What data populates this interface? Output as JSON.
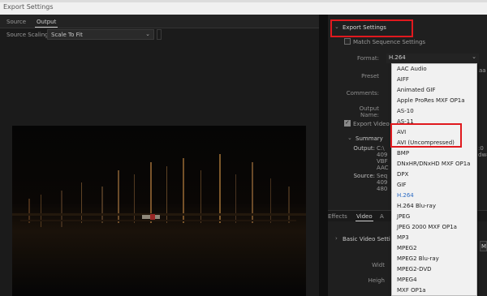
{
  "window": {
    "title": "Export Settings"
  },
  "left": {
    "tabs": [
      {
        "label": "Source"
      },
      {
        "label": "Output",
        "active": true
      }
    ],
    "source_scaling": {
      "label": "Source Scaling:",
      "value": "Scale To Fit"
    }
  },
  "right": {
    "section_title": "Export Settings",
    "match_sequence": "Match Sequence Settings",
    "format_label": "Format:",
    "format_value": "H.264",
    "preset_label": "Preset",
    "comments_label": "Comments:",
    "output_name_label": "Output Name:",
    "export_video": "Export Video",
    "summary": {
      "title": "Summary",
      "output_label": "Output:",
      "output_lines": [
        "C:\\",
        "409",
        "VBF",
        "AAC"
      ],
      "output_right": [
        ":0",
        "dwa"
      ],
      "source_label": "Source:",
      "source_lines": [
        "Seq",
        "409",
        "480"
      ]
    },
    "bottom_tabs": [
      {
        "label": "Effects"
      },
      {
        "label": "Video",
        "active": true
      },
      {
        "label": "A"
      }
    ],
    "basic_video": "Basic Video Setti",
    "width_label": "Widt",
    "height_label": "Heigh",
    "truncated": {
      "aa": "aa",
      "m": "M"
    }
  },
  "dropdown": {
    "items": [
      {
        "label": "AAC Audio"
      },
      {
        "label": "AIFF"
      },
      {
        "label": "Animated GIF"
      },
      {
        "label": "Apple ProRes MXF OP1a"
      },
      {
        "label": "AS-10"
      },
      {
        "label": "AS-11"
      },
      {
        "label": "AVI"
      },
      {
        "label": "AVI (Uncompressed)"
      },
      {
        "label": "BMP"
      },
      {
        "label": "DNxHR/DNxHD MXF OP1a"
      },
      {
        "label": "DPX"
      },
      {
        "label": "GIF"
      },
      {
        "label": "H.264",
        "selected": true
      },
      {
        "label": "H.264 Blu-ray"
      },
      {
        "label": "JPEG"
      },
      {
        "label": "JPEG 2000 MXF OP1a"
      },
      {
        "label": "MP3"
      },
      {
        "label": "MPEG2"
      },
      {
        "label": "MPEG2 Blu-ray"
      },
      {
        "label": "MPEG2-DVD"
      },
      {
        "label": "MPEG4"
      },
      {
        "label": "MXF OP1a"
      }
    ]
  },
  "colors": {
    "highlight_box": "#e0191e",
    "selected_item": "#2d6cc4",
    "dropdown_bg": "#f1f1f1"
  }
}
